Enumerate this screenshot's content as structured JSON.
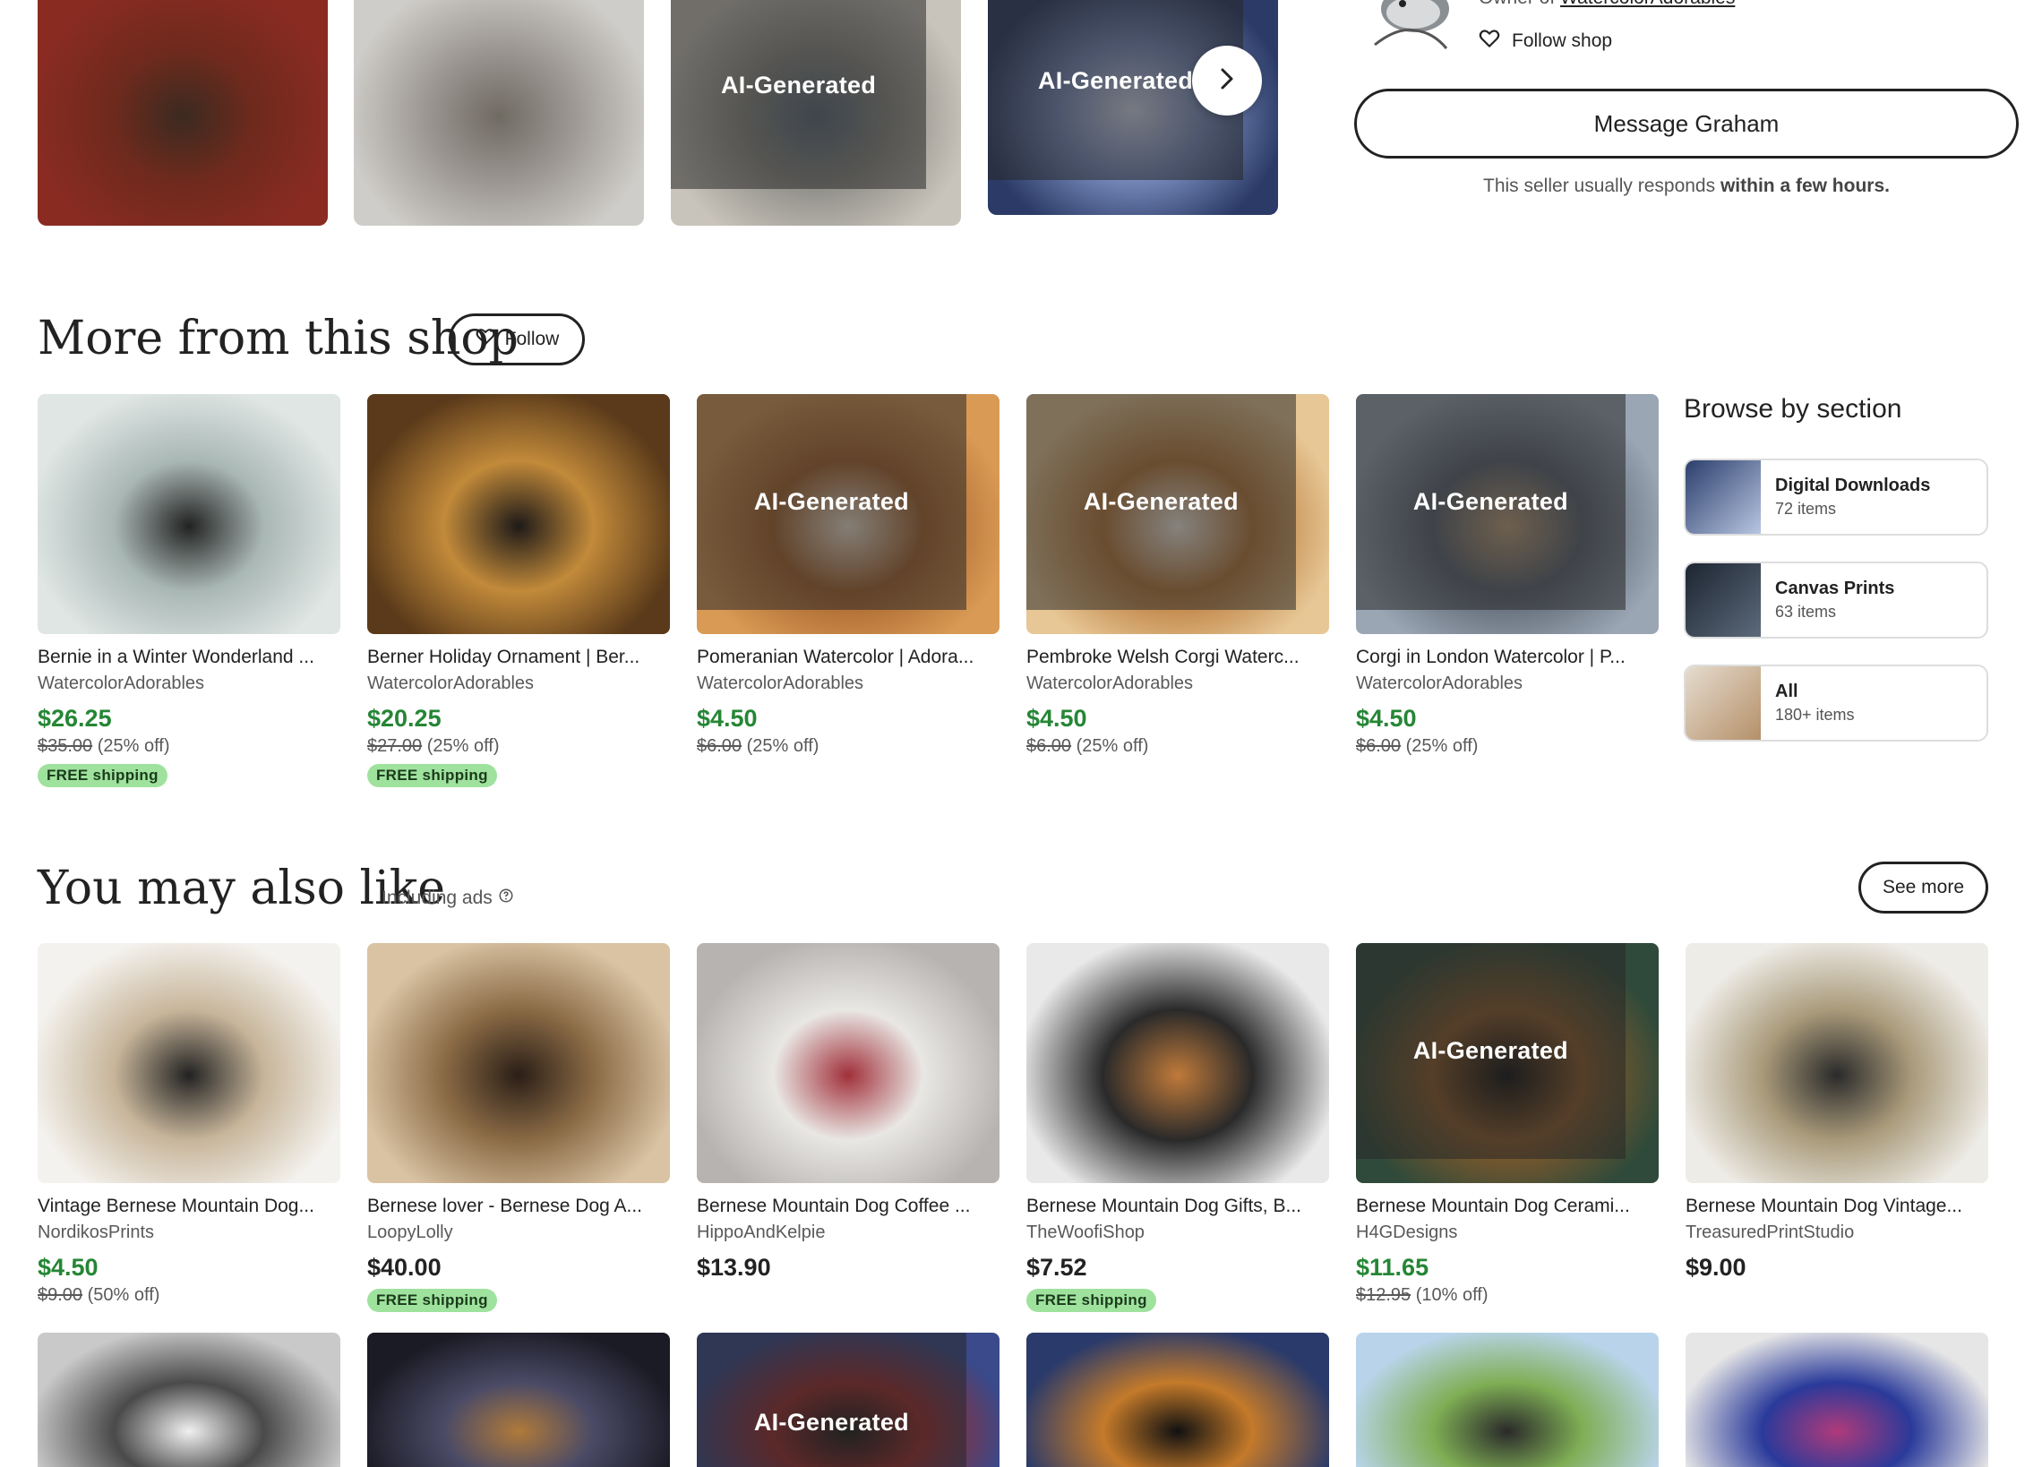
{
  "seller": {
    "owner_prefix": "Owner of",
    "shop_name": "WatercolorAdorables",
    "follow_shop_label": "Follow shop",
    "message_button_label": "Message Graham",
    "responds_prefix": "This seller usually responds",
    "responds_emphasis": "within a few hours."
  },
  "gallery": {
    "tiles": [
      {
        "ai": false,
        "colors": [
          "#8a2b22",
          "#6f2a1d",
          "#3b2a20"
        ]
      },
      {
        "ai": false,
        "colors": [
          "#cfcdc9",
          "#9b9691",
          "#6f6a62"
        ]
      },
      {
        "ai": true,
        "label": "AI-Generated",
        "colors": [
          "#c9c4bb",
          "#8d8c86",
          "#5c6a7a"
        ]
      },
      {
        "ai": true,
        "label": "AI-Generated",
        "colors": [
          "#2b3a66",
          "#7b8fc0",
          "#d7dcef"
        ]
      }
    ]
  },
  "more_from_shop": {
    "heading": "More from this shop",
    "follow_label": "Follow",
    "listings": [
      {
        "title": "Bernie in a Winter Wonderland ...",
        "shop": "WatercolorAdorables",
        "price": "$26.25",
        "original": "$35.00",
        "discount": "(25% off)",
        "free_shipping": "FREE shipping",
        "ai": false,
        "colors": [
          "#dfe6e4",
          "#a9b7b4",
          "#222"
        ]
      },
      {
        "title": "Berner Holiday Ornament | Ber...",
        "shop": "WatercolorAdorables",
        "price": "$20.25",
        "original": "$27.00",
        "discount": "(25% off)",
        "free_shipping": "FREE shipping",
        "ai": false,
        "colors": [
          "#5a3a1a",
          "#c28a3a",
          "#1e1a18"
        ]
      },
      {
        "title": "Pomeranian Watercolor | Adora...",
        "shop": "WatercolorAdorables",
        "price": "$4.50",
        "original": "$6.00",
        "discount": "(25% off)",
        "free_shipping": "",
        "ai": true,
        "label": "AI-Generated",
        "colors": [
          "#d99a55",
          "#a8652e",
          "#f4e6d4"
        ]
      },
      {
        "title": "Pembroke Welsh Corgi Waterc...",
        "shop": "WatercolorAdorables",
        "price": "$4.50",
        "original": "$6.00",
        "discount": "(25% off)",
        "free_shipping": "",
        "ai": true,
        "label": "AI-Generated",
        "colors": [
          "#e7c796",
          "#b97a3a",
          "#f6efe5"
        ]
      },
      {
        "title": "Corgi in London Watercolor | P...",
        "shop": "WatercolorAdorables",
        "price": "$4.50",
        "original": "$6.00",
        "discount": "(25% off)",
        "free_shipping": "",
        "ai": true,
        "label": "AI-Generated",
        "colors": [
          "#9aa6b4",
          "#5c6470",
          "#c3a37c"
        ]
      }
    ]
  },
  "browse": {
    "title": "Browse by section",
    "sections": [
      {
        "name": "Digital Downloads",
        "count": "72 items",
        "colors": [
          "#2a3d6b",
          "#b9c7e2"
        ]
      },
      {
        "name": "Canvas Prints",
        "count": "63 items",
        "colors": [
          "#1c2430",
          "#5d6b7c"
        ]
      },
      {
        "name": "All",
        "count": "180+ items",
        "colors": [
          "#e6ddd0",
          "#b48f68"
        ]
      }
    ]
  },
  "also_like": {
    "heading": "You may also like",
    "including_ads": "Including ads",
    "see_more_label": "See more",
    "listings": [
      {
        "title": "Vintage Bernese Mountain Dog...",
        "shop": "NordikosPrints",
        "price": "$4.50",
        "price_style": "sale",
        "original": "$9.00",
        "discount": "(50% off)",
        "free_shipping": "",
        "ai": false,
        "colors": [
          "#f4f2ee",
          "#c7b59a",
          "#222"
        ]
      },
      {
        "title": "Bernese lover - Bernese Dog A...",
        "shop": "LoopyLolly",
        "price": "$40.00",
        "price_style": "regular",
        "original": "",
        "discount": "",
        "free_shipping": "FREE shipping",
        "ai": false,
        "colors": [
          "#d9c3a3",
          "#8a6a45",
          "#2a1e16"
        ]
      },
      {
        "title": "Bernese Mountain Dog Coffee ...",
        "shop": "HippoAndKelpie",
        "price": "$13.90",
        "price_style": "regular",
        "original": "",
        "discount": "",
        "free_shipping": "",
        "ai": false,
        "colors": [
          "#b6b3b0",
          "#e9e7e4",
          "#a1303a"
        ]
      },
      {
        "title": "Bernese Mountain Dog Gifts, B...",
        "shop": "TheWoofiShop",
        "price": "$7.52",
        "price_style": "regular",
        "original": "",
        "discount": "",
        "free_shipping": "FREE shipping",
        "ai": false,
        "colors": [
          "#e9e9e9",
          "#2a2a2a",
          "#c07a3a"
        ]
      },
      {
        "title": "Bernese Mountain Dog Cerami...",
        "shop": "H4GDesigns",
        "price": "$11.65",
        "price_style": "sale",
        "original": "$12.95",
        "discount": "(10% off)",
        "free_shipping": "",
        "ai": true,
        "label": "AI-Generated",
        "colors": [
          "#2f4a3a",
          "#8a5a2a",
          "#111"
        ]
      },
      {
        "title": "Bernese Mountain Dog Vintage...",
        "shop": "TreasuredPrintStudio",
        "price": "$9.00",
        "price_style": "regular",
        "original": "",
        "discount": "",
        "free_shipping": "",
        "ai": false,
        "colors": [
          "#eeece7",
          "#a99a7a",
          "#2a2a2a"
        ]
      }
    ]
  },
  "bottom_row": [
    {
      "ai": false,
      "colors": [
        "#c9c9c9",
        "#4a4a4a",
        "#f0f0f0"
      ]
    },
    {
      "ai": false,
      "colors": [
        "#1b1b25",
        "#4a4a66",
        "#b07a3a"
      ]
    },
    {
      "ai": true,
      "label": "AI-Generated",
      "colors": [
        "#3a4a8a",
        "#9a2a2a",
        "#1a1a1a"
      ]
    },
    {
      "ai": false,
      "colors": [
        "#2a3a6a",
        "#c47a2a",
        "#111"
      ]
    },
    {
      "ai": false,
      "colors": [
        "#b9d4ea",
        "#7fae55",
        "#2a2a2a"
      ]
    },
    {
      "ai": false,
      "colors": [
        "#e6e6e6",
        "#2a3a9a",
        "#b03a7a"
      ]
    }
  ]
}
